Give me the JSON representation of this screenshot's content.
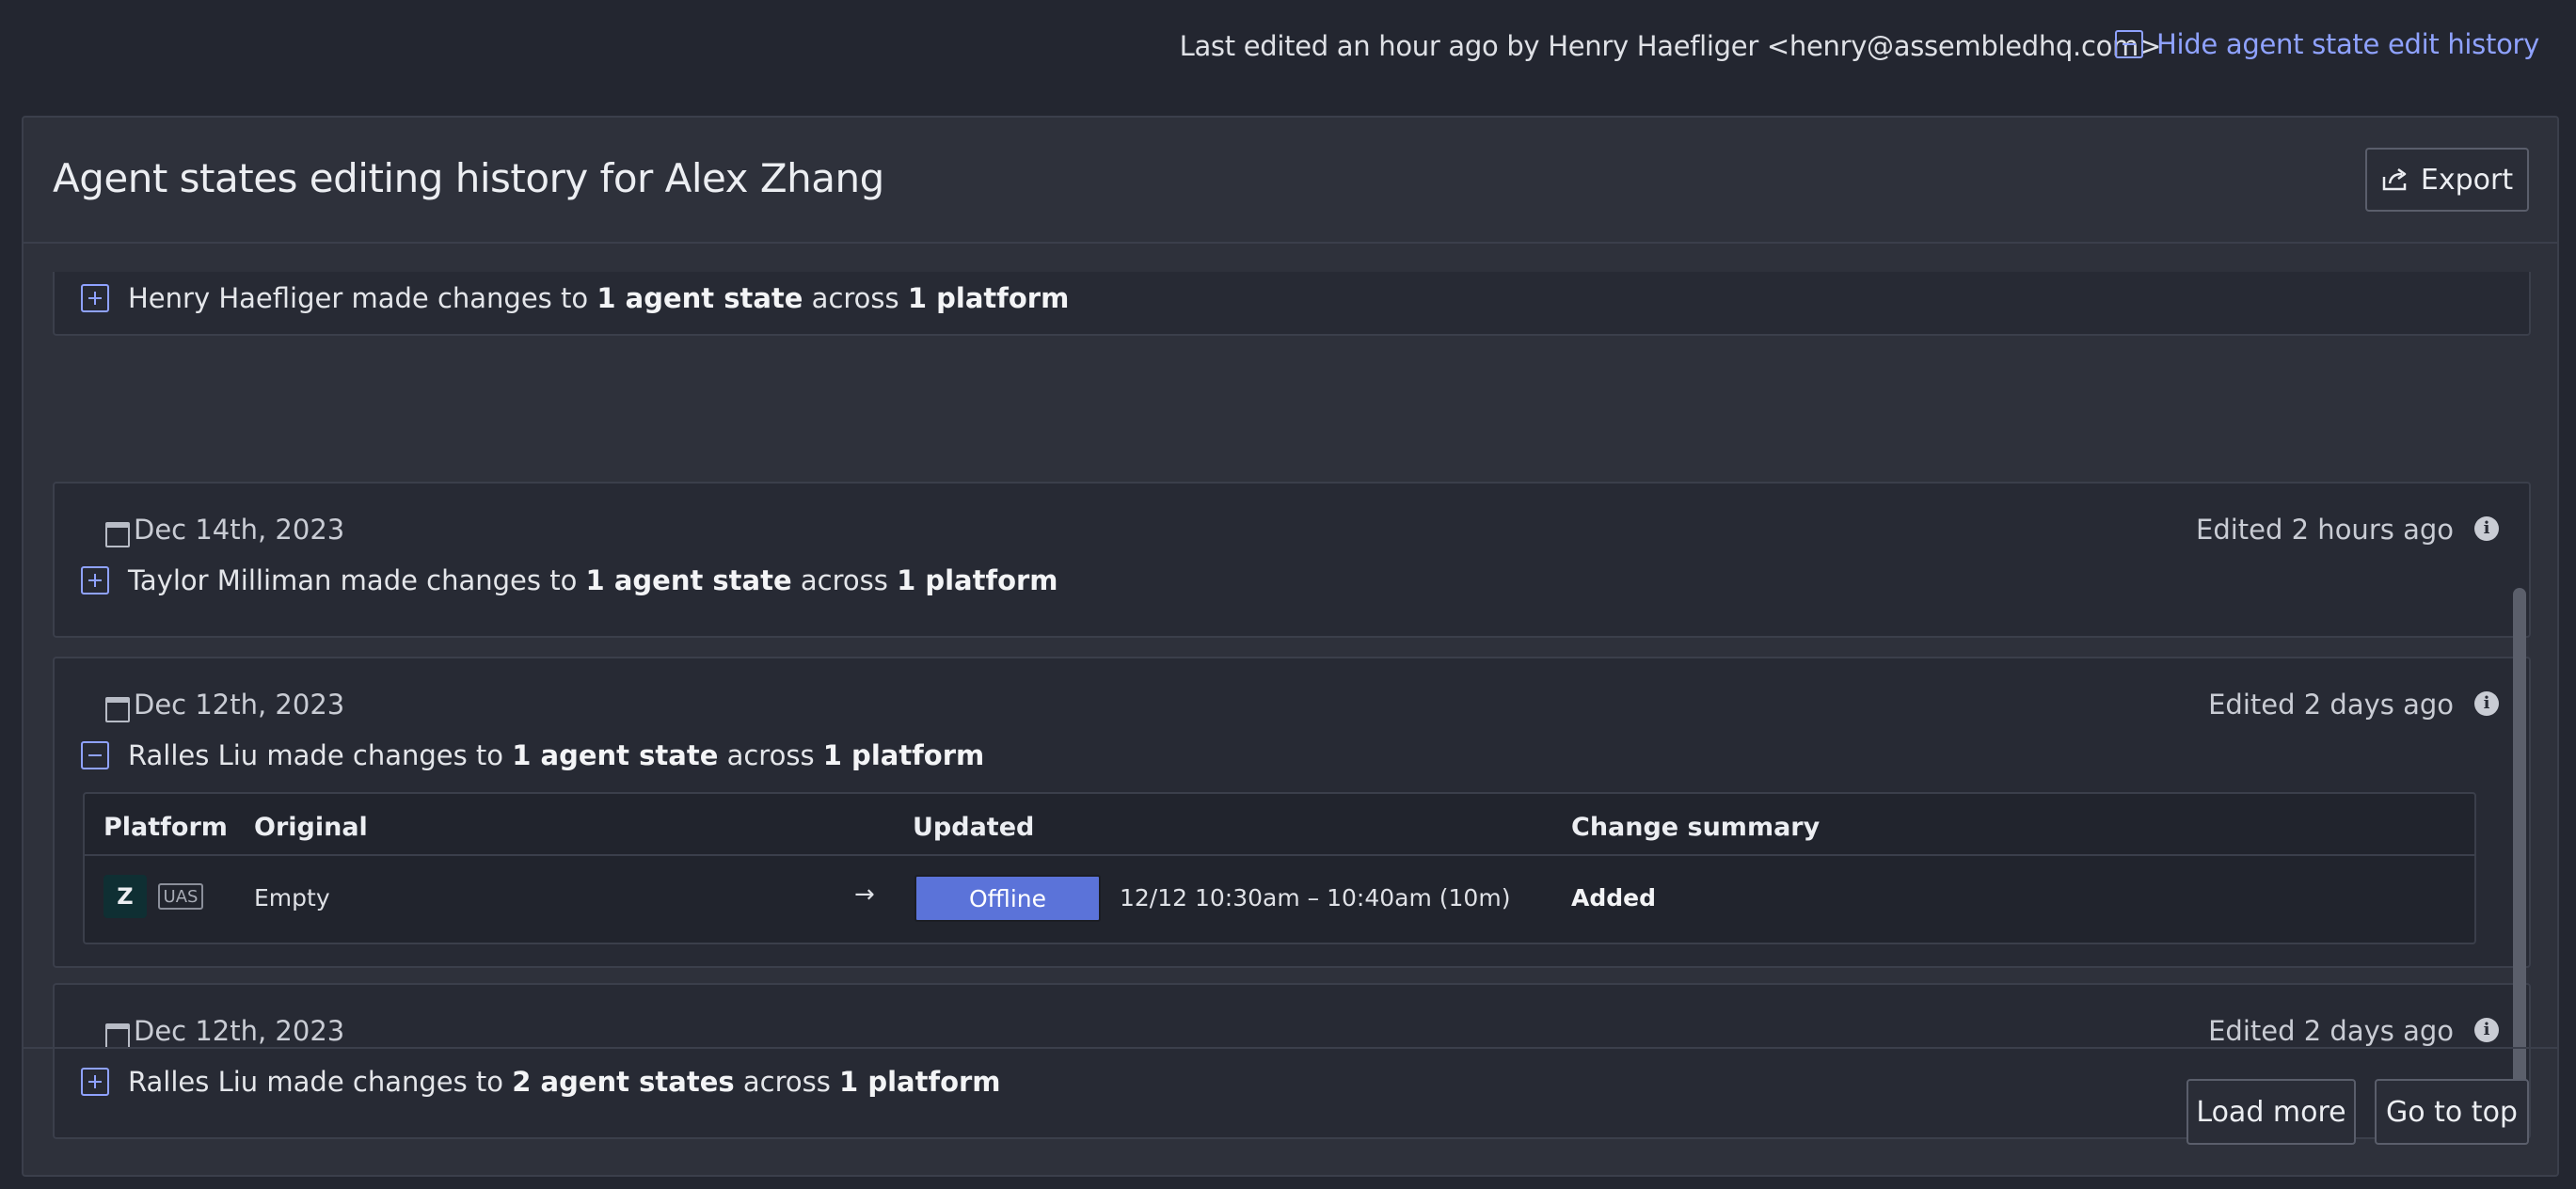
{
  "top": {
    "last_edited": "Last edited an hour ago by Henry Haefliger <henry@assembledhq.com>",
    "hide_history_label": "Hide agent state edit history"
  },
  "panel": {
    "title": "Agent states editing history for Alex Zhang",
    "export_label": "Export"
  },
  "entries": [
    {
      "author": "Henry Haefliger",
      "made_changes": "made changes to",
      "count": "1 agent state",
      "across": "across",
      "platforms": "1 platform"
    },
    {
      "date": "Dec 14th, 2023",
      "edited": "Edited 2 hours ago",
      "author": "Taylor Milliman",
      "made_changes": "made changes to",
      "count": "1 agent state",
      "across": "across",
      "platforms": "1 platform"
    },
    {
      "date": "Dec 12th, 2023",
      "edited": "Edited 2 days ago",
      "author": "Ralles Liu",
      "made_changes": "made changes to",
      "count": "1 agent state",
      "across": "across",
      "platforms": "1 platform",
      "expanded": true,
      "table": {
        "headers": [
          "Platform",
          "Original",
          "Updated",
          "Change summary"
        ],
        "rows": [
          {
            "platform_logo": "Z",
            "platform_tag": "UAS",
            "original": "Empty",
            "arrow": "→",
            "updated_state": "Offline",
            "updated_time": "12/12 10:30am – 10:40am (10m)",
            "summary": "Added"
          }
        ]
      }
    },
    {
      "date": "Dec 12th, 2023",
      "edited": "Edited 2 days ago",
      "author": "Ralles Liu",
      "made_changes": "made changes to",
      "count": "2 agent states",
      "across": "across",
      "platforms": "1 platform"
    }
  ],
  "footer": {
    "load_more_label": "Load more",
    "go_to_top_label": "Go to top"
  },
  "colors": {
    "accent": "#8fa2ff",
    "offline_chip": "#5b73d9",
    "background": "#232630",
    "panel": "#2e313b"
  },
  "icons": [
    "minus-square-icon",
    "plus-square-icon",
    "calendar-icon",
    "info-icon",
    "share-export-icon",
    "zendesk-logo-icon"
  ]
}
